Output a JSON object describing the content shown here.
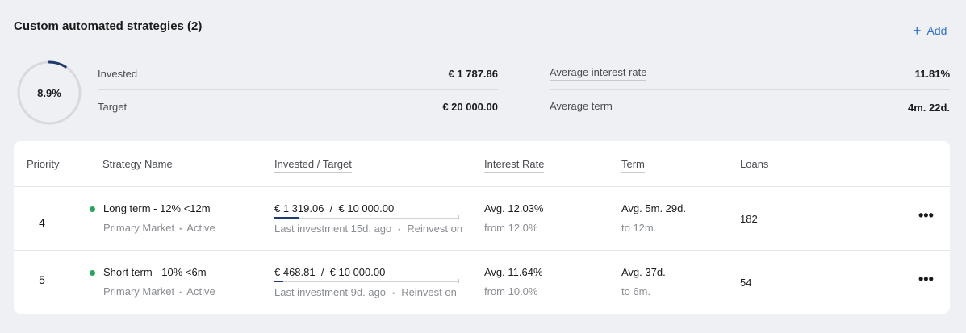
{
  "section": {
    "title": "Custom automated strategies (2)",
    "add_label": "Add"
  },
  "summary": {
    "progress_percent_label": "8.9%",
    "progress_fraction": 0.089,
    "invested_label": "Invested",
    "invested_value": "€ 1 787.86",
    "target_label": "Target",
    "target_value": "€ 20 000.00",
    "avg_rate_label": "Average interest rate",
    "avg_rate_value": "11.81%",
    "avg_term_label": "Average term",
    "avg_term_value": "4m. 22d."
  },
  "table": {
    "headers": {
      "priority": "Priority",
      "strategy": "Strategy Name",
      "invested": "Invested / Target",
      "rate": "Interest Rate",
      "term": "Term",
      "loans": "Loans"
    },
    "rows": [
      {
        "priority": "4",
        "name": "Long term - 12% <12m",
        "market": "Primary Market",
        "status": "Active",
        "invested_target": "€ 1 319.06  /  € 10 000.00",
        "invested_fraction": 0.132,
        "last_investment": "Last investment 15d. ago",
        "reinvest": "Reinvest on",
        "rate": "Avg. 12.03%",
        "rate_sub": "from 12.0%",
        "term": "Avg. 5m. 29d.",
        "term_sub": "to 12m.",
        "loans": "182",
        "more": "•••"
      },
      {
        "priority": "5",
        "name": "Short term - 10% <6m",
        "market": "Primary Market",
        "status": "Active",
        "invested_target": "€ 468.81  /  € 10 000.00",
        "invested_fraction": 0.047,
        "last_investment": "Last investment 9d. ago",
        "reinvest": "Reinvest on",
        "rate": "Avg. 11.64%",
        "rate_sub": "from 10.0%",
        "term": "Avg. 37d.",
        "term_sub": "to 6m.",
        "loans": "54",
        "more": "•••"
      }
    ]
  },
  "colors": {
    "accent": "#2f6fd6",
    "progress": "#1f3a6e",
    "active_dot": "#27a55a"
  }
}
